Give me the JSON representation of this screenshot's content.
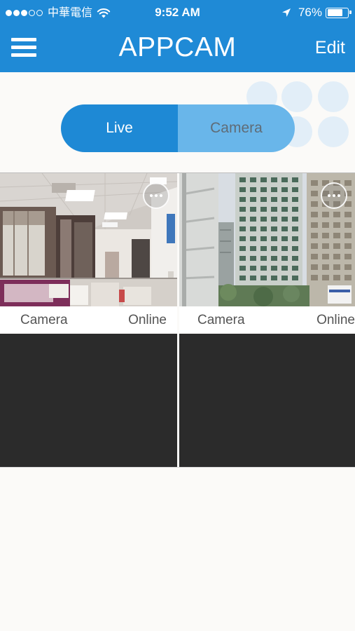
{
  "status_bar": {
    "carrier": "中華電信",
    "time": "9:52 AM",
    "battery_percent_text": "76%",
    "battery_level": 0.76,
    "signal_bars_filled": 3,
    "signal_bars_total": 5,
    "icons": [
      "wifi-icon",
      "location-arrow-icon",
      "battery-icon"
    ]
  },
  "nav": {
    "title": "APPCAM",
    "edit_label": "Edit",
    "menu_icon": "hamburger-menu-icon"
  },
  "segment": {
    "options": [
      {
        "label": "Live",
        "selected": true
      },
      {
        "label": "Camera",
        "selected": false
      }
    ]
  },
  "cameras": [
    {
      "name": "Camera",
      "status": "Online",
      "has_feed": true,
      "menu_icon": "more-options-icon"
    },
    {
      "name": "Camera",
      "status": "Online",
      "has_feed": true,
      "menu_icon": "more-options-icon"
    },
    {
      "name": "",
      "status": "",
      "has_feed": false
    },
    {
      "name": "",
      "status": "",
      "has_feed": false
    }
  ],
  "colors": {
    "header_blue": "#1f8ad6",
    "segment_selected": "#1e89d5",
    "segment_unselected": "#69b6ea",
    "empty_tile": "#2b2b2b",
    "background": "#fbfaf8"
  }
}
